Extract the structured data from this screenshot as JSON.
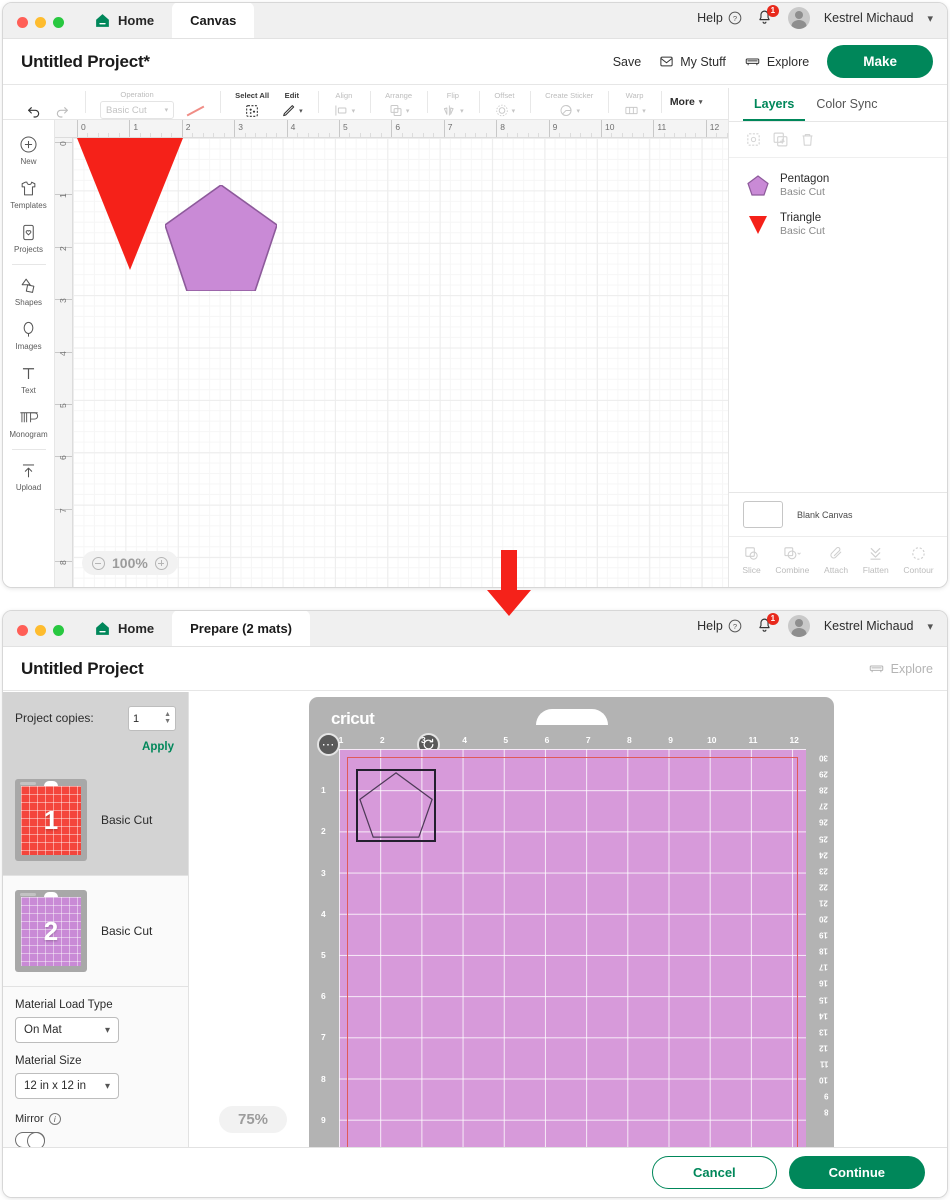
{
  "canvas_window": {
    "tabs": {
      "home": "Home",
      "active": "Canvas"
    },
    "header": {
      "help": "Help",
      "notification_count": "1",
      "user_name": "Kestrel Michaud"
    },
    "project": {
      "title": "Untitled Project*",
      "save": "Save",
      "my_stuff": "My Stuff",
      "explore": "Explore",
      "make": "Make"
    },
    "toolbar": {
      "operation_label": "Operation",
      "operation_value": "Basic Cut",
      "select_all": "Select All",
      "edit": "Edit",
      "align": "Align",
      "arrange": "Arrange",
      "flip": "Flip",
      "offset": "Offset",
      "create_sticker": "Create Sticker",
      "warp": "Warp",
      "more": "More"
    },
    "rail": [
      {
        "label": "New",
        "icon": "plus-circle-icon"
      },
      {
        "label": "Templates",
        "icon": "shirt-icon"
      },
      {
        "label": "Projects",
        "icon": "card-heart-icon"
      },
      {
        "label": "Shapes",
        "icon": "shapes-icon"
      },
      {
        "label": "Images",
        "icon": "balloon-icon"
      },
      {
        "label": "Text",
        "icon": "text-icon"
      },
      {
        "label": "Monogram",
        "icon": "monogram-icon"
      },
      {
        "label": "Upload",
        "icon": "upload-icon"
      }
    ],
    "ruler": {
      "h_ticks": [
        "0",
        "1",
        "2",
        "3",
        "4",
        "5",
        "6",
        "7",
        "8",
        "9",
        "10",
        "11",
        "12"
      ],
      "v_ticks": [
        "0",
        "1",
        "2",
        "3",
        "4",
        "5",
        "6",
        "7",
        "8"
      ]
    },
    "zoom": "100%",
    "shapes": [
      {
        "name": "Triangle",
        "color": "#f52119"
      },
      {
        "name": "Pentagon",
        "color": "#c98ad6"
      }
    ],
    "layers_panel": {
      "tab_layers": "Layers",
      "tab_color_sync": "Color Sync",
      "items": [
        {
          "name": "Pentagon",
          "operation": "Basic Cut",
          "color": "#c98ad6",
          "shape": "pentagon"
        },
        {
          "name": "Triangle",
          "operation": "Basic Cut",
          "color": "#f52119",
          "shape": "triangle"
        }
      ],
      "blank_canvas": "Blank Canvas",
      "boolean_tools": [
        "Slice",
        "Combine",
        "Attach",
        "Flatten",
        "Contour"
      ]
    }
  },
  "prepare_window": {
    "tabs": {
      "home": "Home",
      "active": "Prepare (2 mats)"
    },
    "header": {
      "help": "Help",
      "notification_count": "1",
      "user_name": "Kestrel Michaud"
    },
    "project": {
      "title": "Untitled Project",
      "explore": "Explore"
    },
    "sidebar": {
      "project_copies_label": "Project copies:",
      "project_copies_value": "1",
      "apply": "Apply",
      "mats": [
        {
          "number": "1",
          "label": "Basic Cut",
          "color": "#f4453c",
          "selected": true
        },
        {
          "number": "2",
          "label": "Basic Cut",
          "color": "#c98ad6",
          "selected": false
        }
      ],
      "material_load_type_label": "Material Load Type",
      "material_load_type_value": "On Mat",
      "material_size_label": "Material Size",
      "material_size_value": "12 in x 12 in",
      "mirror_label": "Mirror",
      "mirror_on": false
    },
    "mat": {
      "brand": "cricut",
      "top_ticks": [
        "1",
        "2",
        "3",
        "4",
        "5",
        "6",
        "7",
        "8",
        "9",
        "10",
        "11",
        "12"
      ],
      "left_ticks": [
        "1",
        "2",
        "3",
        "4",
        "5",
        "6",
        "7",
        "8",
        "9"
      ],
      "right_ticks": [
        "30",
        "29",
        "28",
        "27",
        "26",
        "25",
        "24",
        "23",
        "22",
        "21",
        "20",
        "19",
        "18",
        "17",
        "16",
        "15",
        "14",
        "13",
        "12",
        "11",
        "10",
        "9",
        "8"
      ],
      "sheet_color": "#d79ada",
      "selected_shape": "pentagon"
    },
    "zoom": "75%",
    "footer": {
      "cancel": "Cancel",
      "continue": "Continue"
    }
  },
  "annotation": {
    "arrow": "down-arrow",
    "arrow_color": "#f5221a"
  }
}
